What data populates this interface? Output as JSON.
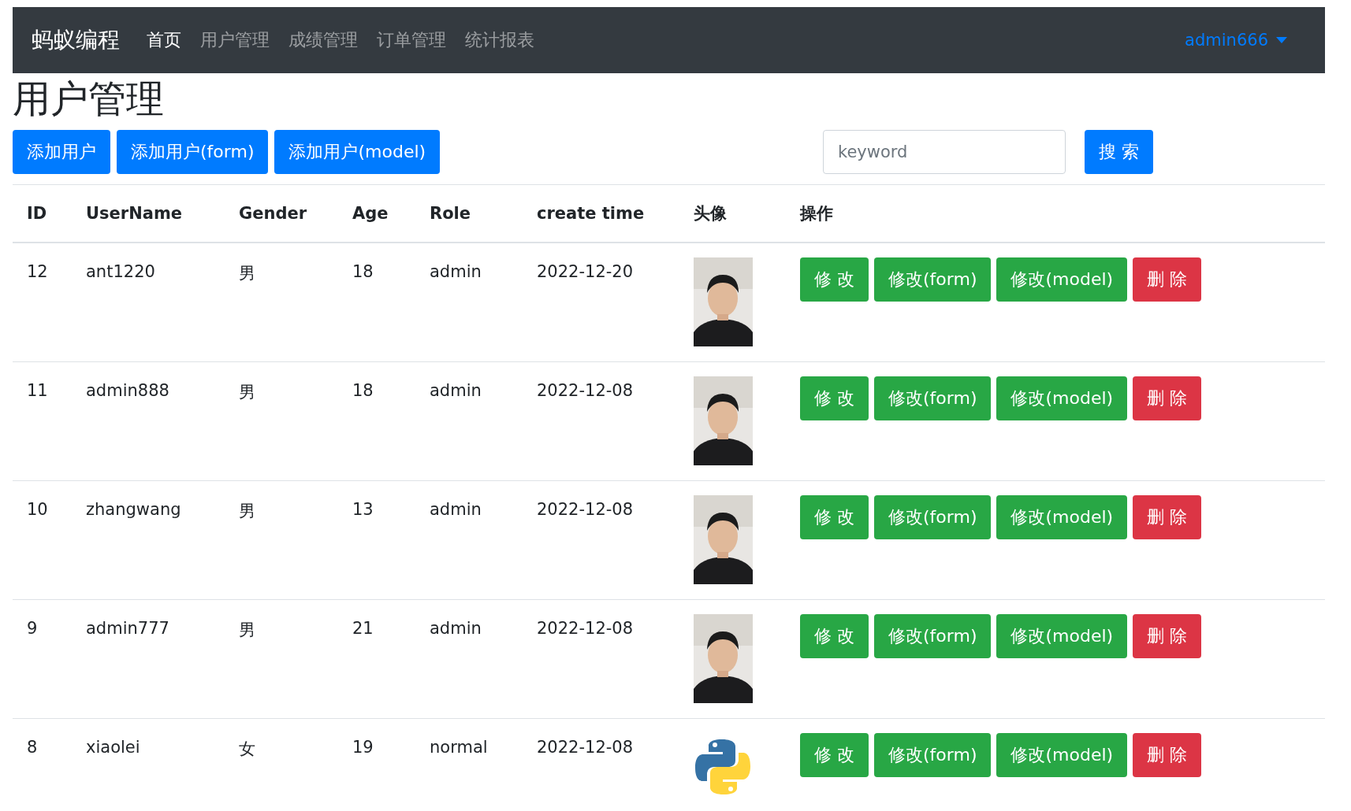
{
  "navbar": {
    "brand": "蚂蚁编程",
    "links": [
      {
        "label": "首页",
        "selected": true
      },
      {
        "label": "用户管理",
        "selected": false
      },
      {
        "label": "成绩管理",
        "selected": false
      },
      {
        "label": "订单管理",
        "selected": false
      },
      {
        "label": "统计报表",
        "selected": false
      }
    ],
    "user": "admin666"
  },
  "title": "用户管理",
  "toolbar": {
    "buttons": [
      "添加用户",
      "添加用户(form)",
      "添加用户(model)"
    ],
    "search": {
      "placeholder": "keyword"
    },
    "search_button": "搜 索"
  },
  "table": {
    "columns": [
      "ID",
      "UserName",
      "Gender",
      "Age",
      "Role",
      "create time",
      "头像",
      "操作"
    ],
    "rows": [
      {
        "id": "12",
        "username": "ant1220",
        "gender": "男",
        "age": "18",
        "role": "admin",
        "create_time": "2022-12-20",
        "avatar": {
          "kind": "picture"
        },
        "actions": [
          {
            "kind": "edit",
            "label": "修 改"
          },
          {
            "kind": "edit",
            "label": "修改(form)"
          },
          {
            "kind": "edit",
            "label": "修改(model)"
          },
          {
            "kind": "delete",
            "label": "删 除"
          }
        ]
      },
      {
        "id": "11",
        "username": "admin888",
        "gender": "男",
        "age": "18",
        "role": "admin",
        "create_time": "2022-12-08",
        "avatar": {
          "kind": "picture"
        },
        "actions": [
          {
            "kind": "edit",
            "label": "修 改"
          },
          {
            "kind": "edit",
            "label": "修改(form)"
          },
          {
            "kind": "edit",
            "label": "修改(model)"
          },
          {
            "kind": "delete",
            "label": "删 除"
          }
        ]
      },
      {
        "id": "10",
        "username": "zhangwang",
        "gender": "男",
        "age": "13",
        "role": "admin",
        "create_time": "2022-12-08",
        "avatar": {
          "kind": "picture"
        },
        "actions": [
          {
            "kind": "edit",
            "label": "修 改"
          },
          {
            "kind": "edit",
            "label": "修改(form)"
          },
          {
            "kind": "edit",
            "label": "修改(model)"
          },
          {
            "kind": "delete",
            "label": "删 除"
          }
        ]
      },
      {
        "id": "9",
        "username": "admin777",
        "gender": "男",
        "age": "21",
        "role": "admin",
        "create_time": "2022-12-08",
        "avatar": {
          "kind": "picture"
        },
        "actions": [
          {
            "kind": "edit",
            "label": "修 改"
          },
          {
            "kind": "edit",
            "label": "修改(form)"
          },
          {
            "kind": "edit",
            "label": "修改(model)"
          },
          {
            "kind": "delete",
            "label": "删 除"
          }
        ]
      },
      {
        "id": "8",
        "username": "xiaolei",
        "gender": "女",
        "age": "19",
        "role": "normal",
        "create_time": "2022-12-08",
        "avatar": {
          "kind": "logo"
        },
        "actions": [
          {
            "kind": "edit",
            "label": "修 改"
          },
          {
            "kind": "edit",
            "label": "修改(form)"
          },
          {
            "kind": "edit",
            "label": "修改(model)"
          },
          {
            "kind": "delete",
            "label": "删 除"
          }
        ]
      }
    ]
  }
}
